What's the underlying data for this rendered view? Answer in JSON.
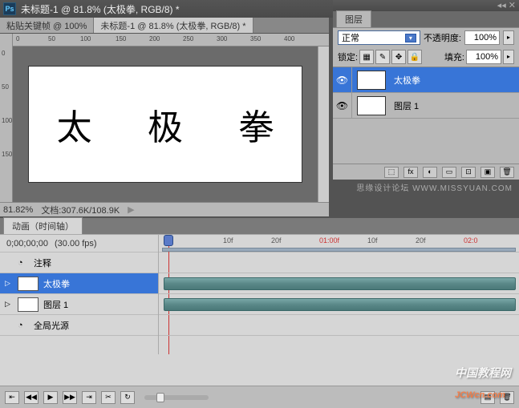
{
  "titlebar": {
    "ps_label": "Ps",
    "title": "未标题-1 @ 81.8% (太极拳, RGB/8) *",
    "min": "—",
    "max": "🗖",
    "close": "✕"
  },
  "doc_tabs": [
    {
      "label": "粘贴关键帧 @ 100%"
    },
    {
      "label": "未标题-1 @ 81.8% (太极拳, RGB/8) *"
    }
  ],
  "ruler_h": [
    "0",
    "50",
    "100",
    "150",
    "200",
    "250",
    "300",
    "350",
    "400"
  ],
  "ruler_v": [
    "0",
    "50",
    "100",
    "150"
  ],
  "canvas_chars": [
    "太",
    "极",
    "拳"
  ],
  "statusbar": {
    "zoom": "81.82%",
    "doc_label": "文档:",
    "doc_size": "307.6K/108.9K"
  },
  "layers_panel": {
    "tab": "图层",
    "blend_mode": "正常",
    "opacity_label": "不透明度:",
    "opacity_value": "100%",
    "lock_label": "锁定:",
    "fill_label": "填充:",
    "fill_value": "100%",
    "lock_icons": [
      "▦",
      "✎",
      "✥",
      "🔒"
    ],
    "layers": [
      {
        "thumb": "T",
        "name": "太极拳",
        "selected": true
      },
      {
        "thumb": "",
        "name": "图层 1",
        "selected": false
      }
    ],
    "footer_icons": [
      "⬚",
      "fx",
      "◐",
      "▭",
      "⊡",
      "▣",
      "🗑"
    ]
  },
  "watermark1": "思缘设计论坛 WWW.MISSYUAN.COM",
  "timeline": {
    "tab": "动画（时间轴）",
    "time": "0;00;00;00",
    "fps": "(30.00 fps)",
    "tracks": [
      {
        "icon": "clock",
        "name": "注释",
        "expand": ""
      },
      {
        "icon": "T",
        "name": "太极拳",
        "expand": "▷",
        "selected": true,
        "bar": true
      },
      {
        "icon": "box",
        "name": "图层 1",
        "expand": "▷",
        "bar": true
      },
      {
        "icon": "clock",
        "name": "全局光源",
        "expand": ""
      }
    ],
    "ruler_marks": [
      {
        "label": "10f",
        "pos": 80
      },
      {
        "label": "20f",
        "pos": 140
      },
      {
        "label": "01:00f",
        "pos": 200,
        "red": true
      },
      {
        "label": "10f",
        "pos": 260
      },
      {
        "label": "20f",
        "pos": 320
      },
      {
        "label": "02:0",
        "pos": 380,
        "red": true
      }
    ],
    "controls": [
      "⇤",
      "◀◀",
      "▶",
      "▶▶",
      "⇥",
      "✂",
      "↻"
    ]
  },
  "watermark2": {
    "cn": "中国教程网",
    "en": "JCWcn.com"
  }
}
